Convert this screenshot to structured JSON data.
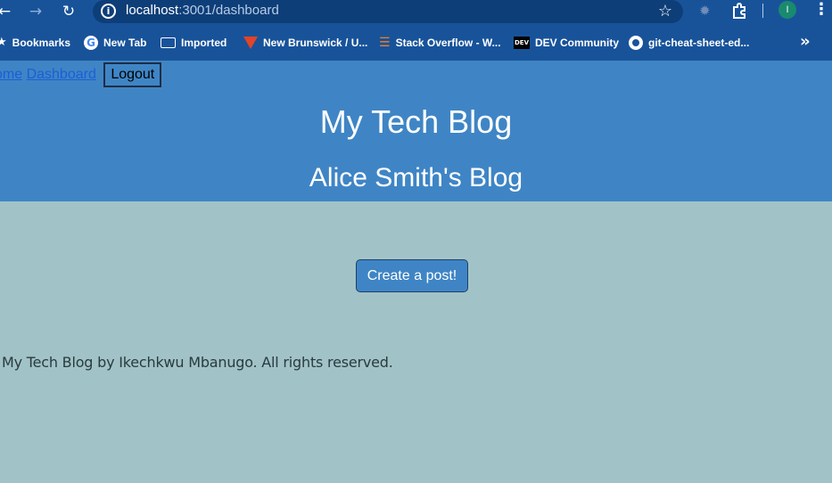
{
  "browser": {
    "url_host": "localhost",
    "url_rest": ":3001/dashboard",
    "profile_initial": "I",
    "bookmarks": [
      {
        "label": "Bookmarks",
        "icon": "star-icon"
      },
      {
        "label": "New Tab",
        "icon": "google-icon"
      },
      {
        "label": "Imported",
        "icon": "folder-icon"
      },
      {
        "label": "New Brunswick / U...",
        "icon": "gitlab-icon"
      },
      {
        "label": "Stack Overflow - W...",
        "icon": "stackoverflow-icon"
      },
      {
        "label": "DEV Community",
        "icon": "dev-icon"
      },
      {
        "label": "git-cheat-sheet-ed...",
        "icon": "github-icon"
      }
    ],
    "dev_badge": "DEV"
  },
  "nav": {
    "home": "ome",
    "dashboard": "Dashboard",
    "logout": "Logout"
  },
  "header": {
    "title": "My Tech Blog",
    "subtitle": "Alice Smith's Blog"
  },
  "main": {
    "create_button": "Create a post!"
  },
  "footer": {
    "text": "My Tech Blog by Ikechkwu Mbanugo. All rights reserved."
  },
  "colors": {
    "chrome": "#18539a",
    "header": "#3f85c5",
    "page_bg": "#a1c3c8"
  }
}
